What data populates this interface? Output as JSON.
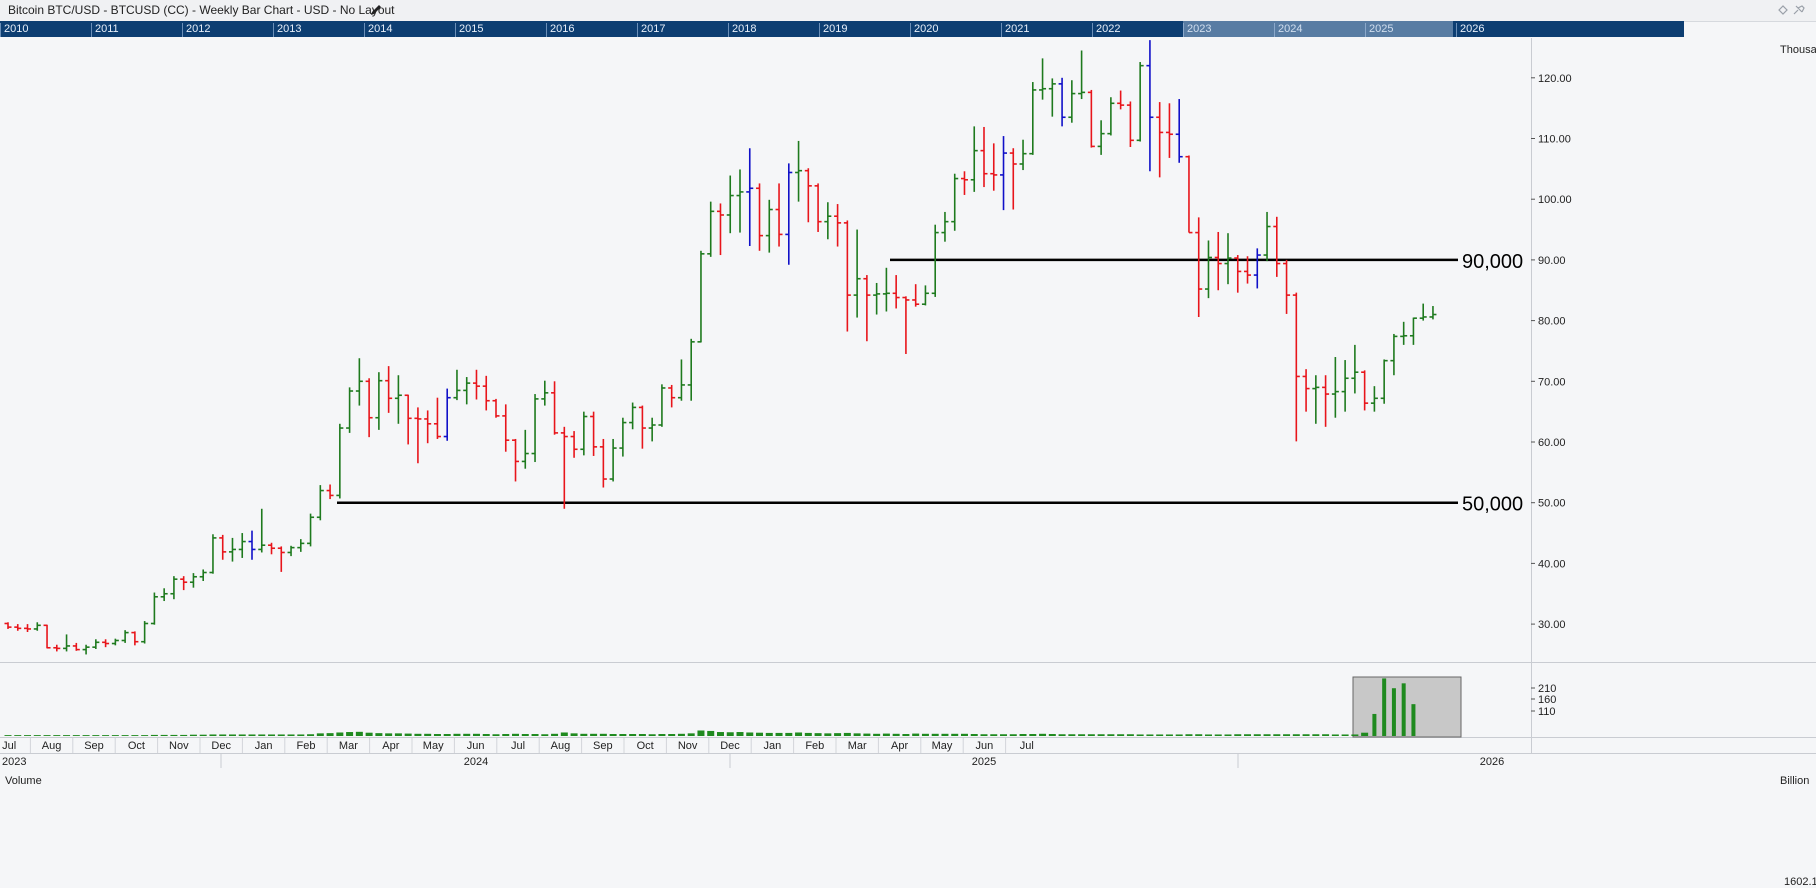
{
  "title": "Bitcoin BTC/USD - BTCUSD (CC) - Weekly Bar Chart - USD - No Layout",
  "navigator_years": [
    "2010",
    "2011",
    "2012",
    "2013",
    "2014",
    "2015",
    "2016",
    "2017",
    "2018",
    "2019",
    "2020",
    "2021",
    "2022",
    "2023",
    "2024",
    "2025",
    "2026"
  ],
  "axis_unit_label": "Thousa",
  "volume_label": "Volume",
  "volume_unit_label": "Billion",
  "volume_ticks": [
    "210",
    "160",
    "110"
  ],
  "bottom_readout": "1602.1",
  "colors": {
    "up": "#1e7a1e",
    "down": "#e8151b",
    "outside": "#1010c8",
    "line": "#000000",
    "volume": "#1f8a1f"
  },
  "chart_data": {
    "type": "ohlc",
    "interval": "weekly",
    "y_unit": "thousands USD",
    "ylim": [
      25,
      125
    ],
    "yticks": [
      "120.00",
      "110.00",
      "100.00",
      "90.00",
      "80.00",
      "70.00",
      "60.00",
      "50.00",
      "40.00",
      "30.00"
    ],
    "month_ticks": [
      "Jul",
      "Aug",
      "Sep",
      "Oct",
      "Nov",
      "Dec",
      "Jan",
      "Feb",
      "Mar",
      "Apr",
      "May",
      "Jun",
      "Jul",
      "Aug",
      "Sep",
      "Oct",
      "Nov",
      "Dec",
      "Jan",
      "Feb",
      "Mar",
      "Apr",
      "May",
      "Jun",
      "Jul"
    ],
    "year_labels": [
      "2023",
      "2024",
      "2025",
      "2026"
    ],
    "horizontal_lines": [
      {
        "value": 90,
        "label": "90,000"
      },
      {
        "value": 50,
        "label": "50,000"
      }
    ],
    "bars": [
      [
        30.1,
        30.3,
        29.2,
        29.5
      ],
      [
        29.5,
        30.0,
        28.9,
        29.3
      ],
      [
        29.3,
        30.0,
        28.7,
        29.2
      ],
      [
        29.2,
        30.3,
        28.9,
        29.8
      ],
      [
        29.8,
        29.9,
        26.0,
        26.1
      ],
      [
        26.1,
        26.6,
        25.5,
        26.0
      ],
      [
        26.0,
        28.3,
        25.5,
        26.4
      ],
      [
        26.4,
        26.9,
        25.6,
        25.8
      ],
      [
        25.8,
        26.6,
        25.0,
        26.2
      ],
      [
        26.2,
        27.5,
        25.9,
        27.0
      ],
      [
        27.0,
        27.5,
        26.2,
        26.8
      ],
      [
        26.8,
        27.6,
        26.5,
        27.3
      ],
      [
        27.3,
        29.0,
        26.9,
        28.6
      ],
      [
        28.6,
        28.8,
        26.5,
        27.1
      ],
      [
        27.1,
        30.5,
        26.8,
        30.1
      ],
      [
        30.1,
        35.2,
        29.9,
        34.5
      ],
      [
        34.5,
        35.9,
        33.8,
        35.0
      ],
      [
        35.0,
        37.9,
        34.1,
        37.4
      ],
      [
        37.4,
        37.9,
        35.6,
        36.9
      ],
      [
        36.9,
        38.4,
        36.0,
        37.8
      ],
      [
        37.8,
        39.0,
        37.1,
        38.5
      ],
      [
        38.5,
        44.8,
        38.3,
        44.2
      ],
      [
        44.2,
        44.7,
        40.6,
        41.9
      ],
      [
        41.9,
        44.2,
        40.3,
        42.3
      ],
      [
        42.3,
        45.0,
        40.9,
        43.6
      ],
      [
        43.6,
        45.4,
        40.6,
        42.3
      ],
      [
        42.3,
        49.0,
        41.8,
        43.0
      ],
      [
        43.0,
        43.4,
        41.5,
        42.5
      ],
      [
        42.5,
        42.8,
        38.6,
        41.8
      ],
      [
        41.8,
        42.9,
        41.2,
        42.6
      ],
      [
        42.6,
        44.0,
        41.9,
        43.3
      ],
      [
        43.3,
        48.2,
        42.8,
        47.6
      ],
      [
        47.6,
        52.9,
        47.1,
        52.0
      ],
      [
        52.0,
        53.0,
        50.6,
        51.2
      ],
      [
        51.2,
        63.0,
        50.7,
        62.3
      ],
      [
        62.3,
        69.0,
        61.5,
        68.4
      ],
      [
        68.4,
        73.8,
        66.0,
        70.0
      ],
      [
        70.0,
        70.5,
        60.8,
        64.0
      ],
      [
        64.0,
        71.5,
        62.0,
        70.1
      ],
      [
        70.1,
        72.5,
        64.8,
        67.2
      ],
      [
        67.2,
        71.0,
        63.0,
        67.7
      ],
      [
        67.7,
        67.8,
        59.6,
        63.9
      ],
      [
        63.9,
        65.7,
        56.5,
        63.8
      ],
      [
        63.8,
        65.2,
        59.8,
        63.0
      ],
      [
        63.0,
        67.3,
        60.5,
        60.9
      ],
      [
        60.9,
        68.8,
        60.2,
        67.3
      ],
      [
        67.3,
        71.9,
        66.9,
        68.5
      ],
      [
        68.5,
        70.7,
        66.2,
        69.7
      ],
      [
        69.7,
        71.9,
        67.0,
        69.2
      ],
      [
        69.2,
        70.9,
        65.2,
        66.8
      ],
      [
        66.8,
        67.1,
        64.0,
        64.3
      ],
      [
        64.3,
        66.2,
        58.4,
        60.3
      ],
      [
        60.3,
        60.5,
        53.5,
        56.8
      ],
      [
        56.8,
        62.0,
        55.6,
        58.1
      ],
      [
        58.1,
        67.9,
        56.7,
        67.1
      ],
      [
        67.1,
        70.1,
        66.0,
        68.1
      ],
      [
        68.1,
        70.0,
        61.2,
        61.5
      ],
      [
        61.5,
        62.5,
        49.0,
        60.9
      ],
      [
        60.9,
        61.8,
        57.4,
        58.8
      ],
      [
        58.8,
        65.0,
        57.8,
        64.2
      ],
      [
        64.2,
        65.0,
        57.7,
        59.2
      ],
      [
        59.2,
        60.5,
        52.5,
        53.9
      ],
      [
        53.9,
        60.5,
        53.5,
        59.0
      ],
      [
        59.0,
        64.0,
        57.6,
        63.2
      ],
      [
        63.2,
        66.5,
        62.1,
        65.7
      ],
      [
        65.7,
        66.0,
        58.9,
        62.3
      ],
      [
        62.3,
        64.0,
        60.1,
        62.8
      ],
      [
        62.8,
        69.5,
        62.5,
        68.9
      ],
      [
        68.9,
        69.4,
        65.7,
        67.3
      ],
      [
        67.3,
        73.6,
        66.8,
        69.4
      ],
      [
        69.4,
        77.0,
        66.8,
        76.5
      ],
      [
        76.5,
        91.5,
        76.4,
        91.0
      ],
      [
        91.0,
        99.6,
        90.5,
        98.0
      ],
      [
        98.0,
        99.3,
        90.8,
        97.4
      ],
      [
        97.4,
        103.9,
        94.4,
        100.6
      ],
      [
        100.6,
        104.9,
        94.5,
        101.2
      ],
      [
        101.2,
        108.4,
        92.3,
        101.8
      ],
      [
        101.8,
        102.6,
        91.5,
        94.0
      ],
      [
        94.0,
        99.9,
        91.2,
        98.3
      ],
      [
        98.3,
        102.6,
        92.2,
        94.2
      ],
      [
        94.2,
        105.9,
        89.2,
        104.4
      ],
      [
        104.4,
        109.6,
        99.6,
        104.7
      ],
      [
        104.7,
        105.1,
        96.2,
        102.2
      ],
      [
        102.2,
        102.6,
        94.6,
        96.3
      ],
      [
        96.3,
        99.5,
        93.4,
        97.2
      ],
      [
        97.2,
        99.2,
        92.2,
        96.1
      ],
      [
        96.1,
        96.5,
        78.2,
        84.2
      ],
      [
        84.2,
        95.0,
        80.5,
        86.9
      ],
      [
        86.9,
        87.5,
        76.6,
        84.2
      ],
      [
        84.2,
        86.2,
        81.0,
        84.4
      ],
      [
        84.4,
        88.7,
        81.5,
        84.5
      ],
      [
        84.5,
        87.5,
        82.0,
        83.8
      ],
      [
        83.8,
        84.0,
        74.5,
        83.4
      ],
      [
        83.4,
        86.0,
        82.3,
        82.7
      ],
      [
        82.7,
        85.8,
        82.5,
        84.5
      ],
      [
        84.5,
        95.8,
        83.9,
        94.5
      ],
      [
        94.5,
        97.9,
        93.0,
        96.3
      ],
      [
        96.3,
        104.2,
        94.8,
        103.4
      ],
      [
        103.4,
        104.6,
        100.7,
        103.2
      ],
      [
        103.2,
        112.0,
        101.2,
        108.0
      ],
      [
        108.0,
        111.9,
        102.0,
        104.2
      ],
      [
        104.2,
        109.2,
        101.4,
        104.0
      ],
      [
        104.0,
        110.4,
        98.2,
        107.6
      ],
      [
        107.6,
        108.4,
        98.3,
        105.8
      ],
      [
        105.8,
        109.8,
        104.8,
        107.5
      ],
      [
        107.5,
        119.3,
        107.3,
        118.0
      ],
      [
        118.0,
        123.2,
        116.4,
        118.2
      ],
      [
        118.2,
        119.9,
        113.6,
        119.0
      ],
      [
        119.0,
        120.0,
        112.0,
        113.5
      ],
      [
        113.5,
        119.6,
        112.6,
        117.4
      ],
      [
        117.4,
        124.5,
        116.5,
        117.6
      ],
      [
        117.6,
        118.0,
        108.5,
        108.7
      ],
      [
        108.7,
        113.0,
        107.3,
        110.8
      ],
      [
        110.8,
        116.8,
        110.5,
        115.8
      ],
      [
        115.8,
        117.9,
        114.8,
        115.5
      ],
      [
        115.5,
        116.1,
        108.6,
        109.7
      ],
      [
        109.7,
        122.6,
        109.5,
        122.0
      ],
      [
        122.0,
        126.2,
        104.6,
        113.5
      ],
      [
        113.5,
        116.0,
        103.6,
        111.0
      ],
      [
        111.0,
        115.8,
        106.8,
        110.7
      ],
      [
        110.7,
        116.5,
        106.0,
        107.0
      ],
      [
        107.0,
        107.2,
        94.5,
        94.5
      ],
      [
        94.5,
        97.0,
        80.6,
        85.2
      ],
      [
        85.2,
        93.2,
        83.7,
        90.4
      ],
      [
        90.4,
        94.6,
        85.0,
        89.4
      ],
      [
        89.4,
        94.4,
        86.0,
        90.3
      ],
      [
        90.3,
        90.8,
        84.6,
        88.1
      ],
      [
        88.1,
        90.6,
        86.1,
        87.5
      ],
      [
        87.5,
        91.9,
        85.3,
        90.8
      ],
      [
        90.8,
        97.9,
        89.8,
        95.5
      ],
      [
        95.5,
        97.1,
        87.2,
        89.4
      ],
      [
        89.4,
        90.0,
        81.1,
        84.2
      ],
      [
        84.2,
        84.6,
        60.1,
        70.8
      ],
      [
        70.8,
        72.0,
        65.0,
        68.8
      ],
      [
        68.8,
        71.0,
        63.0,
        69.0
      ],
      [
        69.0,
        71.0,
        62.5,
        67.9
      ],
      [
        67.9,
        74.0,
        64.0,
        68.3
      ],
      [
        68.3,
        73.5,
        65.0,
        70.5
      ],
      [
        70.5,
        76.0,
        68.0,
        71.5
      ],
      [
        71.5,
        71.8,
        65.2,
        66.4
      ],
      [
        66.4,
        69.2,
        65.0,
        67.2
      ],
      [
        67.2,
        73.6,
        66.3,
        73.4
      ],
      [
        73.4,
        77.8,
        71.0,
        77.4
      ],
      [
        77.4,
        79.8,
        76.0,
        77.5
      ],
      [
        77.5,
        80.5,
        76.0,
        80.4
      ],
      [
        80.4,
        82.8,
        80.0,
        80.6
      ],
      [
        80.6,
        82.4,
        80.2,
        81.0
      ]
    ],
    "volume_bars": [
      0.4,
      0.4,
      0.4,
      0.4,
      0.4,
      0.4,
      0.4,
      0.4,
      0.4,
      0.4,
      0.4,
      0.4,
      0.4,
      0.4,
      0.4,
      0.5,
      0.5,
      0.5,
      0.5,
      0.6,
      0.6,
      0.7,
      0.7,
      0.7,
      0.7,
      0.7,
      0.7,
      0.7,
      0.7,
      0.7,
      0.7,
      0.8,
      1.2,
      1.3,
      1.6,
      1.8,
      1.9,
      1.5,
      1.3,
      1.2,
      1.2,
      1.1,
      1.0,
      1.0,
      0.9,
      0.9,
      1.0,
      1.0,
      1.0,
      0.9,
      0.8,
      0.9,
      1.0,
      0.9,
      0.9,
      0.8,
      1.0,
      1.6,
      1.2,
      1.0,
      1.0,
      1.0,
      0.9,
      0.9,
      0.9,
      0.9,
      0.8,
      0.9,
      0.9,
      1.0,
      1.2,
      2.5,
      2.3,
      1.8,
      1.7,
      1.8,
      1.6,
      1.5,
      1.4,
      1.4,
      1.4,
      1.6,
      1.4,
      1.3,
      1.2,
      1.3,
      1.4,
      1.2,
      1.1,
      1.0,
      1.1,
      1.0,
      0.9,
      1.1,
      1.0,
      1.0,
      1.0,
      1.0,
      1.0,
      0.9,
      0.8,
      0.8,
      0.8,
      0.8,
      0.9,
      0.9,
      1.0,
      0.9,
      0.8,
      0.8,
      0.8,
      0.8,
      0.8,
      0.8,
      0.8,
      0.8,
      0.7,
      0.7,
      0.7,
      0.7,
      0.7,
      0.8,
      0.8,
      0.7,
      0.7,
      0.7,
      0.8,
      0.8,
      0.8,
      0.8,
      0.8,
      0.8,
      0.8,
      0.8,
      0.8,
      0.8,
      0.7,
      0.7,
      0.7,
      1.5,
      90,
      235,
      195,
      215,
      130
    ]
  }
}
